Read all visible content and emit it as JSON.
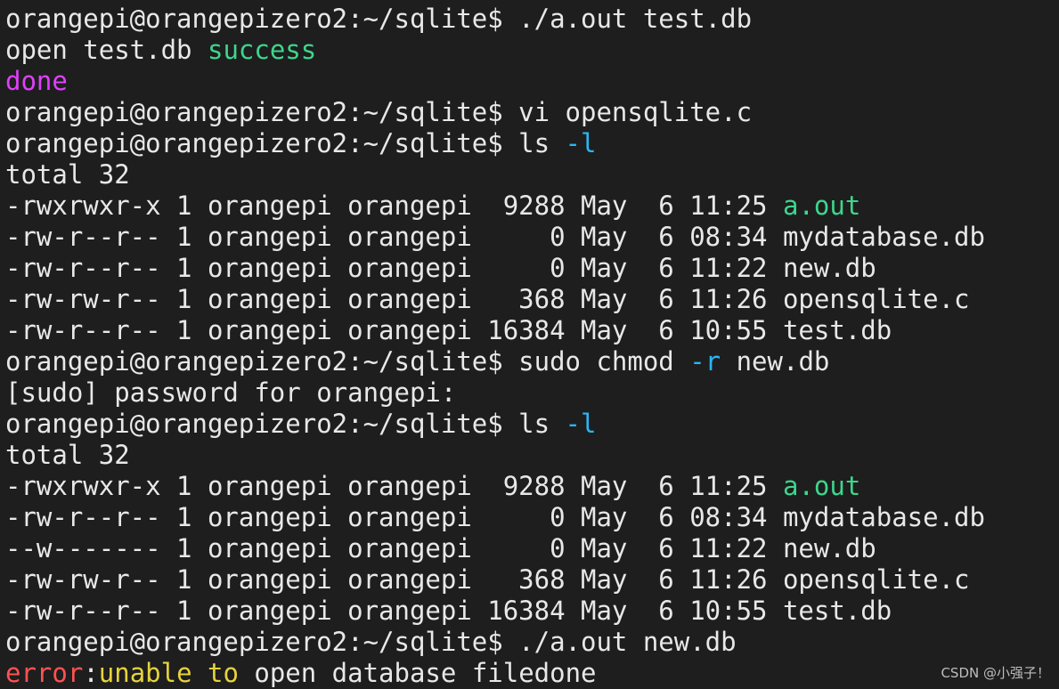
{
  "terminal": {
    "prompt": "orangepi@orangepizero2:~/sqlite$",
    "lines": [
      {
        "segments": [
          {
            "text": "orangepi@orangepizero2:~/sqlite$ ./a.out test.db",
            "color": "default"
          }
        ]
      },
      {
        "segments": [
          {
            "text": "open test.db ",
            "color": "default"
          },
          {
            "text": "success",
            "color": "green"
          }
        ]
      },
      {
        "segments": [
          {
            "text": "done",
            "color": "magenta"
          }
        ]
      },
      {
        "segments": [
          {
            "text": "orangepi@orangepizero2:~/sqlite$ vi opensqlite.c",
            "color": "default"
          }
        ]
      },
      {
        "segments": [
          {
            "text": "orangepi@orangepizero2:~/sqlite$ ls ",
            "color": "default"
          },
          {
            "text": "-l",
            "color": "cyan"
          }
        ]
      },
      {
        "segments": [
          {
            "text": "total 32",
            "color": "default"
          }
        ]
      },
      {
        "segments": [
          {
            "text": "-rwxrwxr-x 1 orangepi orangepi  9288 May  6 11:25 ",
            "color": "default"
          },
          {
            "text": "a.out",
            "color": "green"
          }
        ]
      },
      {
        "segments": [
          {
            "text": "-rw-r--r-- 1 orangepi orangepi     0 May  6 08:34 mydatabase.db",
            "color": "default"
          }
        ]
      },
      {
        "segments": [
          {
            "text": "-rw-r--r-- 1 orangepi orangepi     0 May  6 11:22 new.db",
            "color": "default"
          }
        ]
      },
      {
        "segments": [
          {
            "text": "-rw-rw-r-- 1 orangepi orangepi   368 May  6 11:26 opensqlite.c",
            "color": "default"
          }
        ]
      },
      {
        "segments": [
          {
            "text": "-rw-r--r-- 1 orangepi orangepi 16384 May  6 10:55 test.db",
            "color": "default"
          }
        ]
      },
      {
        "segments": [
          {
            "text": "orangepi@orangepizero2:~/sqlite$ sudo chmod ",
            "color": "default"
          },
          {
            "text": "-r",
            "color": "cyan"
          },
          {
            "text": " new.db",
            "color": "default"
          }
        ]
      },
      {
        "segments": [
          {
            "text": "[sudo] password for orangepi:",
            "color": "default"
          }
        ]
      },
      {
        "segments": [
          {
            "text": "orangepi@orangepizero2:~/sqlite$ ls ",
            "color": "default"
          },
          {
            "text": "-l",
            "color": "cyan"
          }
        ]
      },
      {
        "segments": [
          {
            "text": "total 32",
            "color": "default"
          }
        ]
      },
      {
        "segments": [
          {
            "text": "-rwxrwxr-x 1 orangepi orangepi  9288 May  6 11:25 ",
            "color": "default"
          },
          {
            "text": "a.out",
            "color": "green"
          }
        ]
      },
      {
        "segments": [
          {
            "text": "-rw-r--r-- 1 orangepi orangepi     0 May  6 08:34 mydatabase.db",
            "color": "default"
          }
        ]
      },
      {
        "segments": [
          {
            "text": "--w------- 1 orangepi orangepi     0 May  6 11:22 new.db",
            "color": "default"
          }
        ]
      },
      {
        "segments": [
          {
            "text": "-rw-rw-r-- 1 orangepi orangepi   368 May  6 11:26 opensqlite.c",
            "color": "default"
          }
        ]
      },
      {
        "segments": [
          {
            "text": "-rw-r--r-- 1 orangepi orangepi 16384 May  6 10:55 test.db",
            "color": "default"
          }
        ]
      },
      {
        "segments": [
          {
            "text": "orangepi@orangepizero2:~/sqlite$ ./a.out new.db",
            "color": "default"
          }
        ]
      },
      {
        "segments": [
          {
            "text": "error",
            "color": "red"
          },
          {
            "text": ":",
            "color": "default"
          },
          {
            "text": "unable to",
            "color": "yellow"
          },
          {
            "text": " open database filedone",
            "color": "default"
          }
        ]
      }
    ]
  },
  "watermark": "CSDN @小强子！",
  "colors": {
    "background": "#1e1e1e",
    "default": "#e8e8e8",
    "green": "#3dd68c",
    "magenta": "#e040fb",
    "cyan": "#29b6f6",
    "red": "#ff5252",
    "yellow": "#e6d33c"
  }
}
